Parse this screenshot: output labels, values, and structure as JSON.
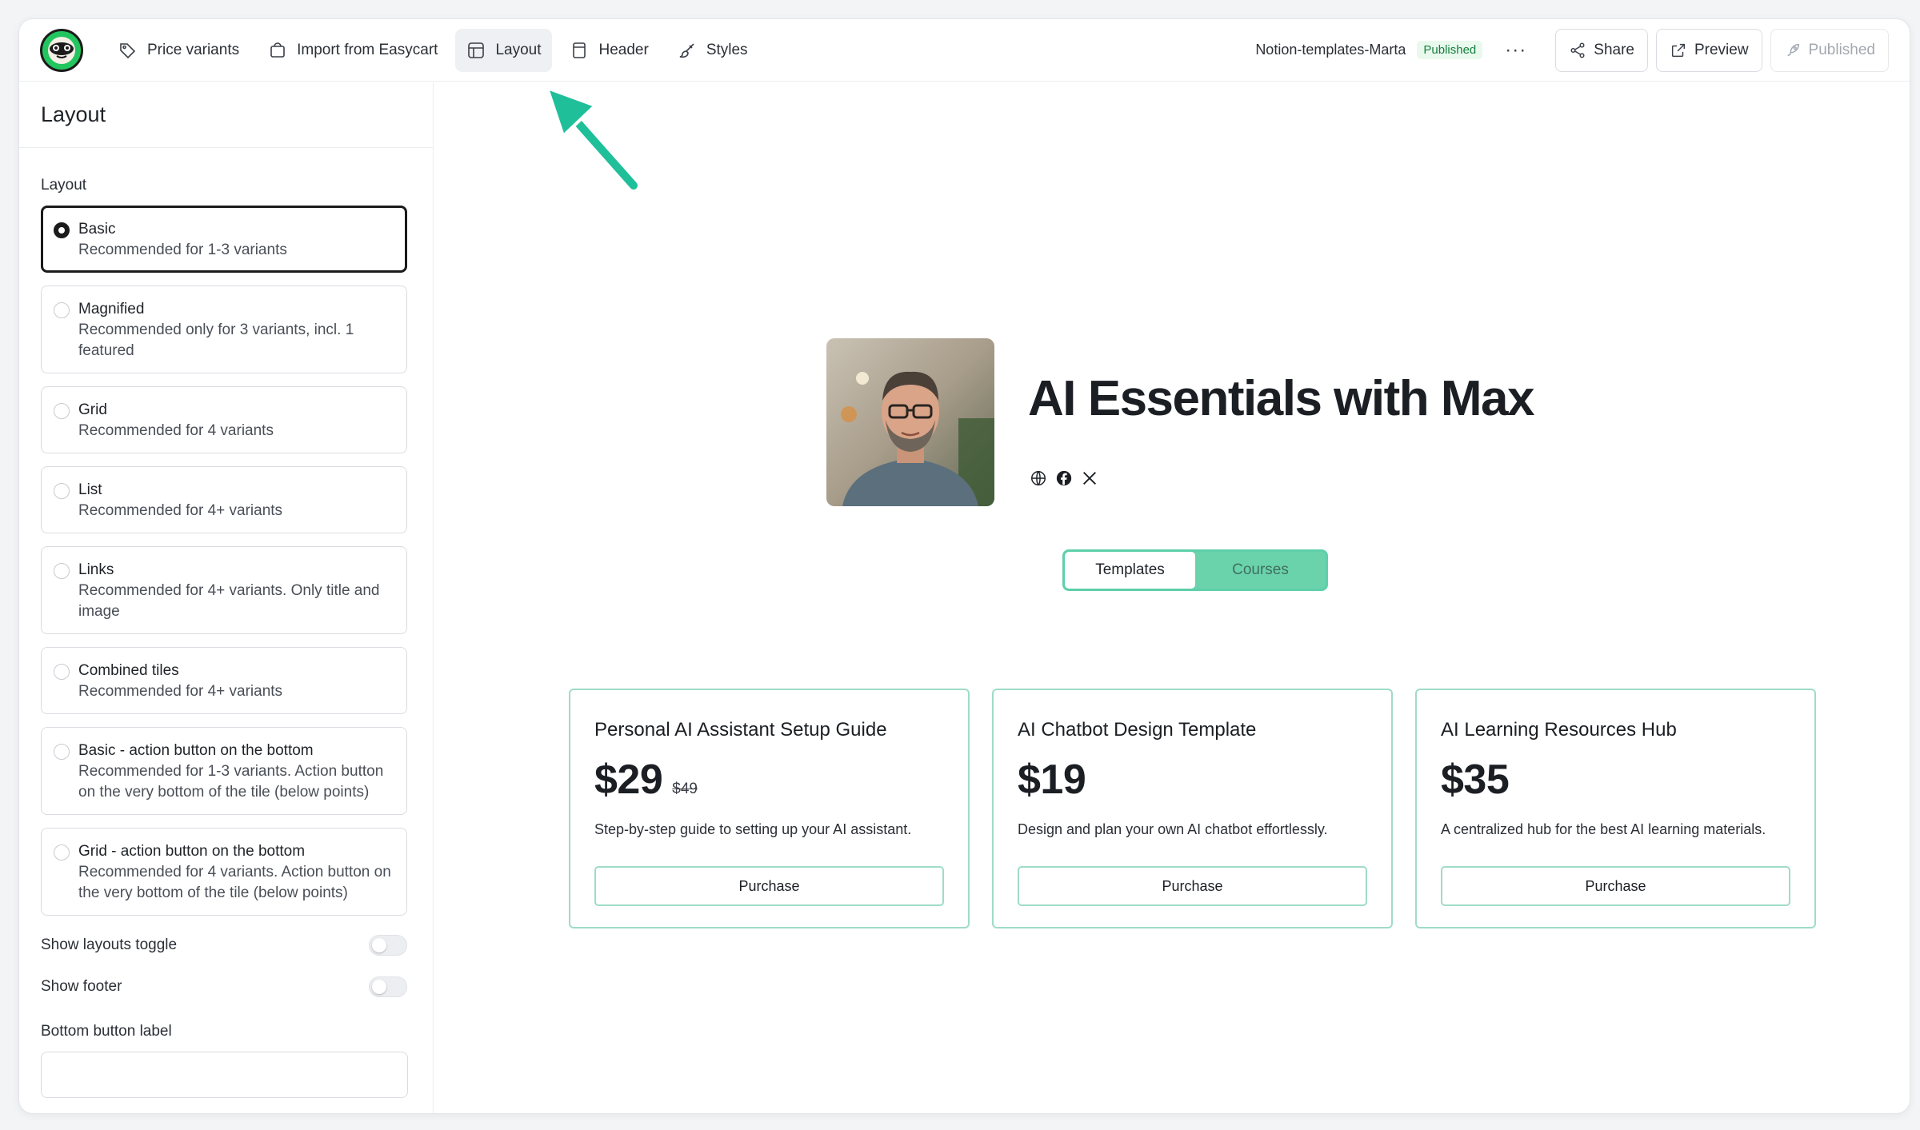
{
  "topbar": {
    "nav": [
      {
        "label": "Price variants",
        "icon": "tag-icon"
      },
      {
        "label": "Import from Easycart",
        "icon": "cart-icon"
      },
      {
        "label": "Layout",
        "icon": "layout-icon",
        "active": true
      },
      {
        "label": "Header",
        "icon": "header-icon"
      },
      {
        "label": "Styles",
        "icon": "brush-icon"
      }
    ],
    "doc_name": "Notion-templates-Marta",
    "status_badge": "Published",
    "more_label": "···",
    "share_label": "Share",
    "preview_label": "Preview",
    "published_label": "Published"
  },
  "sidebar": {
    "title": "Layout",
    "section_label": "Layout",
    "options": [
      {
        "title": "Basic",
        "desc": "Recommended for 1-3 variants",
        "selected": true
      },
      {
        "title": "Magnified",
        "desc": "Recommended only for 3 variants, incl. 1 featured",
        "selected": false
      },
      {
        "title": "Grid",
        "desc": "Recommended for 4 variants",
        "selected": false
      },
      {
        "title": "List",
        "desc": "Recommended for 4+ variants",
        "selected": false
      },
      {
        "title": "Links",
        "desc": "Recommended for 4+ variants. Only title and image",
        "selected": false
      },
      {
        "title": "Combined tiles",
        "desc": "Recommended for 4+ variants",
        "selected": false
      },
      {
        "title": "Basic - action button on the bottom",
        "desc": "Recommended for 1-3 variants. Action button on the very bottom of the tile (below points)",
        "selected": false
      },
      {
        "title": "Grid - action button on the bottom",
        "desc": "Recommended for 4 variants. Action button on the very bottom of the tile (below points)",
        "selected": false
      }
    ],
    "show_layouts_toggle_label": "Show layouts toggle",
    "show_layouts_toggle_on": false,
    "show_footer_label": "Show footer",
    "show_footer_on": false,
    "bottom_button_label": "Bottom button label",
    "bottom_button_value": ""
  },
  "preview": {
    "title": "AI Essentials with Max",
    "socials": [
      "globe-icon",
      "facebook-icon",
      "x-icon"
    ],
    "tabs": [
      {
        "label": "Templates",
        "active": true
      },
      {
        "label": "Courses",
        "active": false
      }
    ],
    "cards": [
      {
        "title": "Personal AI Assistant Setup Guide",
        "price": "$29",
        "old_price": "$49",
        "desc": "Step-by-step guide to setting up your AI assistant.",
        "button": "Purchase"
      },
      {
        "title": "AI Chatbot Design Template",
        "price": "$19",
        "old_price": "",
        "desc": "Design and plan your own AI chatbot effortlessly.",
        "button": "Purchase"
      },
      {
        "title": "AI Learning Resources Hub",
        "price": "$35",
        "old_price": "",
        "desc": "A centralized hub for the best AI learning materials.",
        "button": "Purchase"
      }
    ]
  },
  "colors": {
    "accent": "#5ecfaa",
    "card_border": "#9fdcc6",
    "published_green": "#15803d",
    "annotation_arrow": "#1fbf9a"
  }
}
